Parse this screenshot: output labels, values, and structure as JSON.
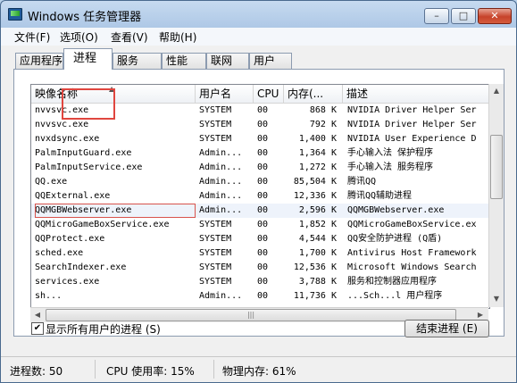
{
  "window": {
    "title": "Windows 任务管理器"
  },
  "menu": [
    {
      "label": "文件(F)"
    },
    {
      "label": "选项(O)"
    },
    {
      "label": "查看(V)"
    },
    {
      "label": "帮助(H)"
    }
  ],
  "tabs": [
    {
      "label": "应用程序"
    },
    {
      "label": "进程"
    },
    {
      "label": "服务"
    },
    {
      "label": "性能"
    },
    {
      "label": "联网"
    },
    {
      "label": "用户"
    }
  ],
  "columns": {
    "name": "映像名称",
    "user": "用户名",
    "cpu": "CPU",
    "mem": "内存(...",
    "desc": "描述"
  },
  "processes": [
    {
      "name": "nvvsvc.exe",
      "user": "SYSTEM",
      "cpu": "00",
      "mem": "868 K",
      "desc": "NVIDIA Driver Helper Ser"
    },
    {
      "name": "nvvsvc.exe",
      "user": "SYSTEM",
      "cpu": "00",
      "mem": "792 K",
      "desc": "NVIDIA Driver Helper Ser"
    },
    {
      "name": "nvxdsync.exe",
      "user": "SYSTEM",
      "cpu": "00",
      "mem": "1,400 K",
      "desc": "NVIDIA User Experience D"
    },
    {
      "name": "PalmInputGuard.exe",
      "user": "Admin...",
      "cpu": "00",
      "mem": "1,364 K",
      "desc": "手心输入法 保护程序"
    },
    {
      "name": "PalmInputService.exe",
      "user": "Admin...",
      "cpu": "00",
      "mem": "1,272 K",
      "desc": "手心输入法 服务程序"
    },
    {
      "name": "QQ.exe",
      "user": "Admin...",
      "cpu": "00",
      "mem": "85,504 K",
      "desc": "腾讯QQ"
    },
    {
      "name": "QQExternal.exe",
      "user": "Admin...",
      "cpu": "00",
      "mem": "12,336 K",
      "desc": "腾讯QQ辅助进程"
    },
    {
      "name": "QQMGBWebserver.exe",
      "user": "Admin...",
      "cpu": "00",
      "mem": "2,596 K",
      "desc": "QQMGBWebserver.exe"
    },
    {
      "name": "QQMicroGameBoxService.exe",
      "user": "SYSTEM",
      "cpu": "00",
      "mem": "1,852 K",
      "desc": "QQMicroGameBoxService.ex"
    },
    {
      "name": "QQProtect.exe",
      "user": "SYSTEM",
      "cpu": "00",
      "mem": "4,544 K",
      "desc": "QQ安全防护进程 (Q盾)"
    },
    {
      "name": "sched.exe",
      "user": "SYSTEM",
      "cpu": "00",
      "mem": "1,700 K",
      "desc": "Antivirus Host Framework"
    },
    {
      "name": "SearchIndexer.exe",
      "user": "SYSTEM",
      "cpu": "00",
      "mem": "12,536 K",
      "desc": "Microsoft Windows Search"
    },
    {
      "name": "services.exe",
      "user": "SYSTEM",
      "cpu": "00",
      "mem": "3,788 K",
      "desc": "服务和控制器应用程序"
    },
    {
      "name": "sh...",
      "user": "Admin...",
      "cpu": "00",
      "mem": "11,736 K",
      "desc": "...Sch...l 用户程序"
    }
  ],
  "show_all_label": "显示所有用户的进程 (S)",
  "end_process_label": "结束进程 (E)",
  "status": {
    "processes": "进程数: 50",
    "cpu": "CPU 使用率: 15%",
    "memory": "物理内存: 61%"
  }
}
